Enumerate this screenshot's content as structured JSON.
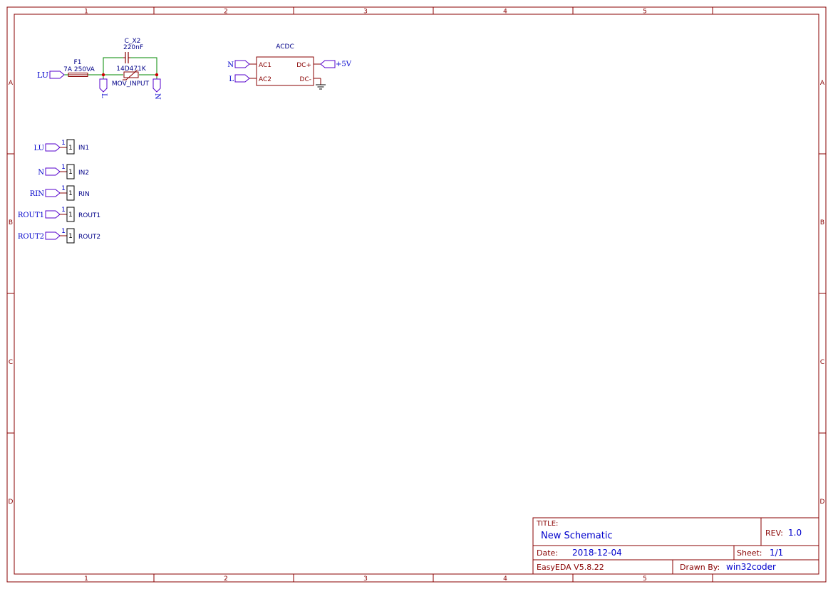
{
  "frame": {
    "columns": [
      "1",
      "2",
      "3",
      "4",
      "5"
    ],
    "rows": [
      "A",
      "B",
      "C",
      "D"
    ]
  },
  "components": {
    "fuse": {
      "designator": "F1",
      "value": "7A 250VA"
    },
    "capacitor": {
      "designator": "C_X2",
      "value": "220nF"
    },
    "varistor": {
      "value": "14D471K",
      "designator": "MOV_INPUT"
    },
    "acdc": {
      "title": "ACDC",
      "pins": {
        "ac1": "AC1",
        "ac2": "AC2",
        "dcp": "DC+",
        "dcm": "DC-"
      }
    }
  },
  "net_ports": {
    "fuse_in": "LU",
    "varistor_left": "L",
    "varistor_right": "N",
    "acdc_ac1": "N",
    "acdc_ac2": "L",
    "acdc_out": "+5V"
  },
  "headers": [
    {
      "net": "LU",
      "pin": "1",
      "num": "1",
      "label": "IN1"
    },
    {
      "net": "N",
      "pin": "1",
      "num": "1",
      "label": "IN2"
    },
    {
      "net": "RIN",
      "pin": "1",
      "num": "1",
      "label": "RIN"
    },
    {
      "net": "ROUT1",
      "pin": "1",
      "num": "1",
      "label": "ROUT1"
    },
    {
      "net": "ROUT2",
      "pin": "1",
      "num": "1",
      "label": "ROUT2"
    }
  ],
  "title_block": {
    "title_label": "TITLE:",
    "title": "New Schematic",
    "rev_label": "REV:",
    "rev": "1.0",
    "date_label": "Date:",
    "date": "2018-12-04",
    "sheet_label": "Sheet:",
    "sheet": "1/1",
    "tool": "EasyEDA V5.8.22",
    "drawn_label": "Drawn By:",
    "drawn_by": "win32coder"
  },
  "colors": {
    "frame": "#880000",
    "wire": "#008800",
    "net": "#0000cc",
    "symbol": "#880000",
    "port": "#5500cc",
    "junction": "#cc0000"
  }
}
